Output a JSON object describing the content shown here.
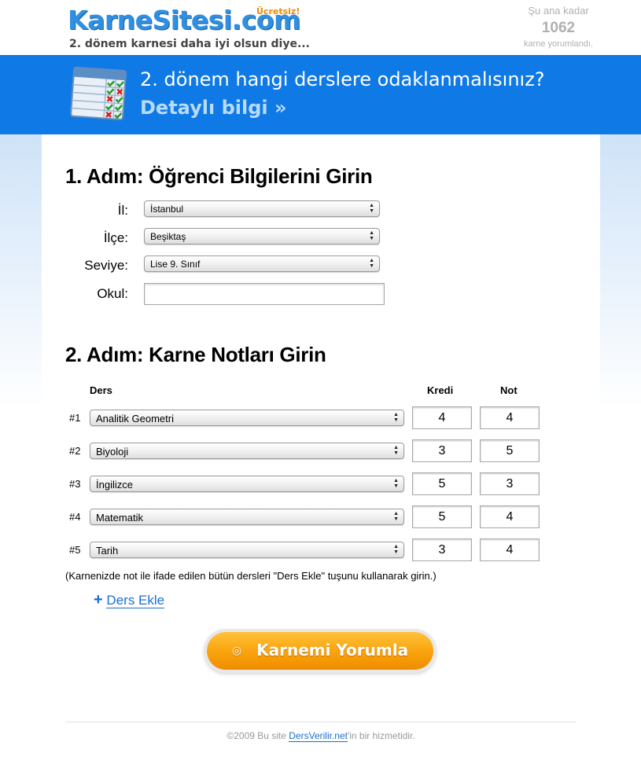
{
  "header": {
    "logo_text": "KarneSitesi.com",
    "logo_badge": "Ücretsiz!",
    "tagline": "2. dönem karnesi daha iyi olsun diye...",
    "counter_prefix": "Şu ana kadar",
    "counter_number": "1062",
    "counter_suffix": "karne yorumlandı."
  },
  "banner": {
    "title": "2. dönem hangi derslere odaklanmalısınız?",
    "link": "Detaylı bilgi »",
    "icon": "checklist-table-icon"
  },
  "step1": {
    "heading": "1. Adım: Öğrenci Bilgilerini Girin",
    "fields": {
      "il_label": "İl:",
      "il_value": "İstanbul",
      "ilce_label": "İlçe:",
      "ilce_value": "Beşiktaş",
      "seviye_label": "Seviye:",
      "seviye_value": "Lise 9. Sınıf",
      "okul_label": "Okul:",
      "okul_value": ""
    }
  },
  "step2": {
    "heading": "2. Adım: Karne Notları Girin",
    "columns": {
      "ders": "Ders",
      "kredi": "Kredi",
      "not": "Not"
    },
    "rows": [
      {
        "num": "#1",
        "ders": "Analitik Geometri",
        "kredi": "4",
        "not": "4"
      },
      {
        "num": "#2",
        "ders": "Biyoloji",
        "kredi": "3",
        "not": "5"
      },
      {
        "num": "#3",
        "ders": "İngilizce",
        "kredi": "5",
        "not": "3"
      },
      {
        "num": "#4",
        "ders": "Matematik",
        "kredi": "5",
        "not": "4"
      },
      {
        "num": "#5",
        "ders": "Tarih",
        "kredi": "3",
        "not": "4"
      }
    ],
    "hint": "(Karnenizde not ile ifade edilen bütün dersleri \"Ders Ekle\" tuşunu kullanarak girin.)",
    "add_course": "Ders Ekle",
    "submit": "Karnemi Yorumla"
  },
  "footer": {
    "prefix": "©2009 Bu site ",
    "link": "DersVerilir.net",
    "suffix": "'in bir hizmetidir."
  },
  "colors": {
    "brand_blue": "#0f7ae5",
    "logo_blue": "#2f8fe0",
    "submit_orange": "#f8a20c",
    "link_blue": "#1a6fd0"
  }
}
